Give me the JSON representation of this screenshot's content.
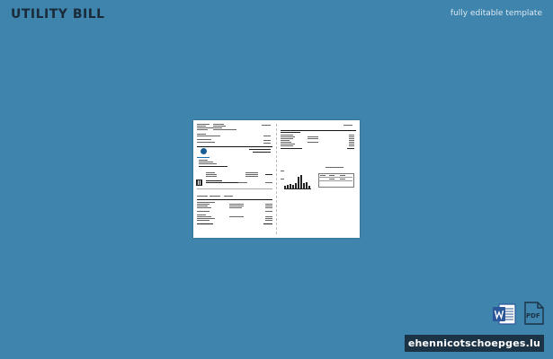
{
  "header": {
    "title": "UTILITY BILL",
    "subtitle": "fully editable template"
  },
  "formats": {
    "word_icon": "word-document-icon",
    "pdf_icon": "pdf-document-icon",
    "pdf_label": "PDF"
  },
  "watermark": {
    "text": "ehennicotschoepges.lu"
  },
  "colors": {
    "background": "#3f84ad",
    "title": "#1a2a38",
    "watermark_bg": "#1c3346",
    "word_blue": "#2b579a"
  }
}
